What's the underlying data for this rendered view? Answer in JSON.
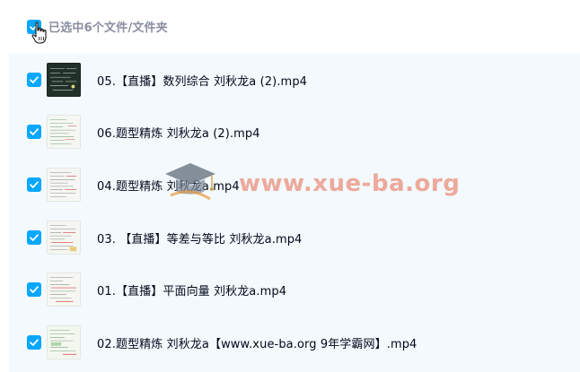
{
  "header": {
    "selection_label": "已选中6个文件/文件夹",
    "select_all_checked": true
  },
  "files": [
    {
      "name": "05.【直播】数列综合 刘秋龙a (2).mp4",
      "checked": true,
      "thumb": "dark"
    },
    {
      "name": "06.题型精炼 刘秋龙a (2).mp4",
      "checked": true,
      "thumb": "light"
    },
    {
      "name": "04.题型精炼 刘秋龙a.mp4",
      "checked": true,
      "thumb": "light"
    },
    {
      "name": "03. 【直播】等差与等比 刘秋龙a.mp4",
      "checked": true,
      "thumb": "light"
    },
    {
      "name": "01.【直播】平面向量 刘秋龙a.mp4",
      "checked": true,
      "thumb": "light"
    },
    {
      "name": "02.题型精炼 刘秋龙a【www.xue-ba.org 9年学霸网】.mp4",
      "checked": true,
      "thumb": "light"
    }
  ],
  "watermark": {
    "text": "www.xue-ba.org"
  },
  "colors": {
    "accent": "#06a7ff",
    "list_background": "#f3f9fd",
    "text": "#03081a",
    "header_text": "#888ea0"
  },
  "icons": {
    "checkbox": "check-icon",
    "cursor": "hand-pointer-icon",
    "watermark_logo": "graduation-cap-icon"
  }
}
